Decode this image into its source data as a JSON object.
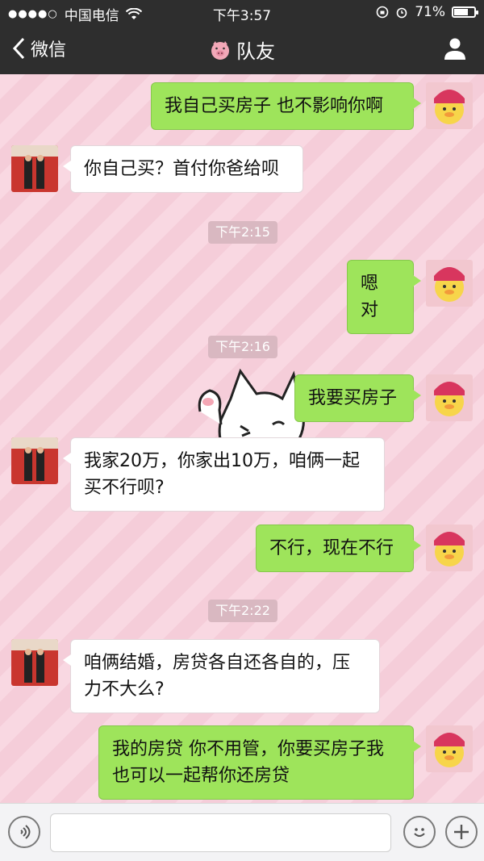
{
  "status": {
    "carrier": "中国电信",
    "time": "下午3:57",
    "battery": "71%",
    "battery_level": 0.71
  },
  "nav": {
    "back_label": "微信",
    "title": "队友"
  },
  "messages": [
    {
      "side": "out",
      "text": "我自己买房子 也不影响你啊"
    },
    {
      "side": "in",
      "text": "你自己买？首付你爸给呗"
    },
    {
      "type": "time",
      "text": "下午2:15"
    },
    {
      "side": "out",
      "text": "嗯 对"
    },
    {
      "type": "time",
      "text": "下午2:16"
    },
    {
      "side": "out",
      "text": "我要买房子"
    },
    {
      "side": "in",
      "text": "我家20万，你家出10万，咱俩一起买不行呗?"
    },
    {
      "side": "out",
      "text": "不行，现在不行"
    },
    {
      "type": "time",
      "text": "下午2:22"
    },
    {
      "side": "in",
      "text": "咱俩结婚，房贷各自还各自的，压力不大么?"
    },
    {
      "side": "out",
      "text": "我的房贷 你不用管，你要买房子我也可以一起帮你还房贷"
    }
  ],
  "colors": {
    "bar": "#2e2e2e",
    "outgoing": "#9ee45b",
    "incoming": "#ffffff",
    "chat_bg": "#f6d2dc"
  }
}
